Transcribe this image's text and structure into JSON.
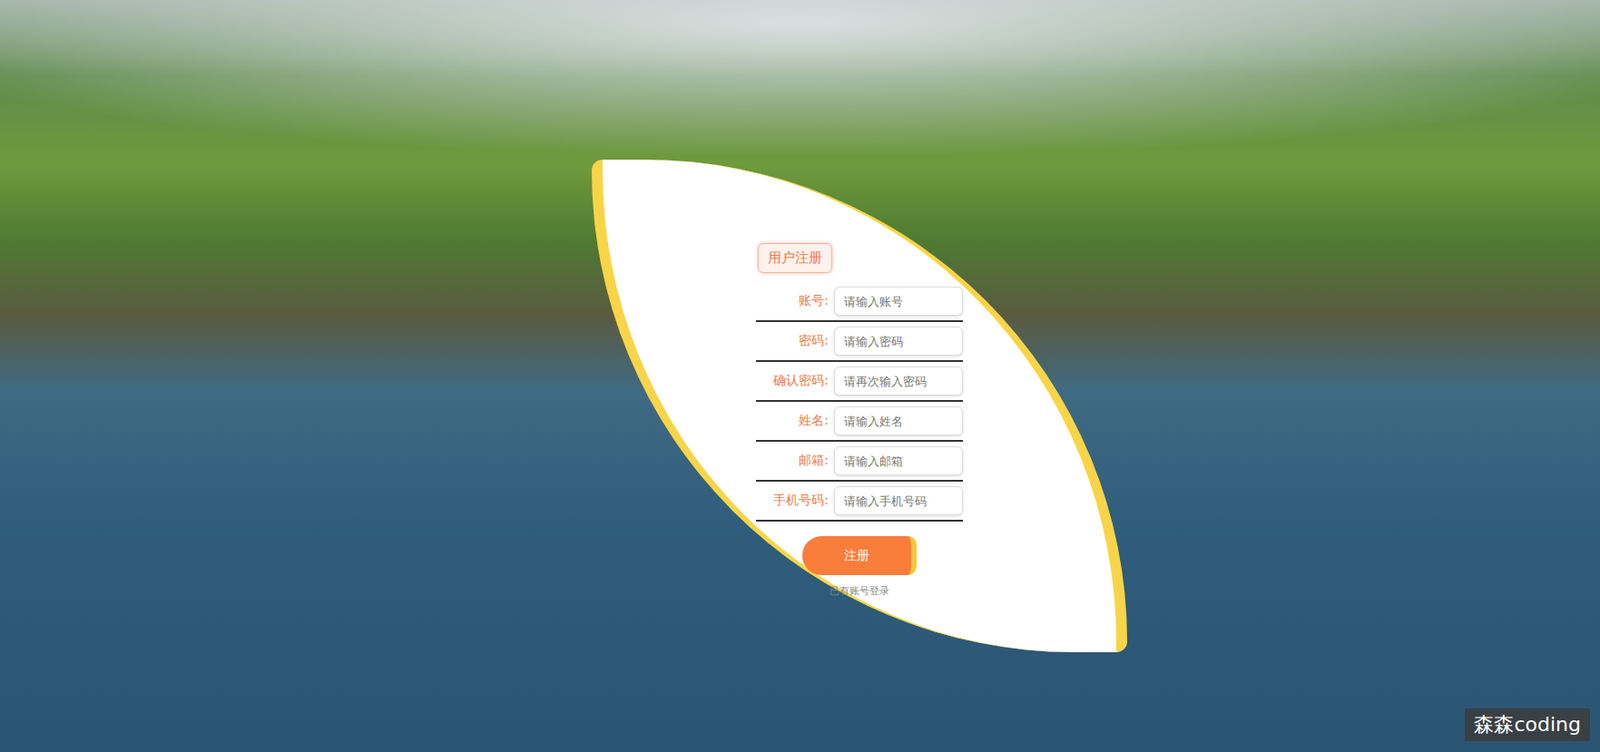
{
  "page": {
    "title": "用户注册"
  },
  "fields": [
    {
      "label": "账号:",
      "placeholder": "请输入账号",
      "type": "text"
    },
    {
      "label": "密码:",
      "placeholder": "请输入密码",
      "type": "password"
    },
    {
      "label": "确认密码:",
      "placeholder": "请再次输入密码",
      "type": "password"
    },
    {
      "label": "姓名:",
      "placeholder": "请输入姓名",
      "type": "text"
    },
    {
      "label": "邮箱:",
      "placeholder": "请输入邮箱",
      "type": "text"
    },
    {
      "label": "手机号码:",
      "placeholder": "请输入手机号码",
      "type": "text"
    }
  ],
  "submit": "注册",
  "login_link": "已有账号登录",
  "watermark": "森森coding"
}
